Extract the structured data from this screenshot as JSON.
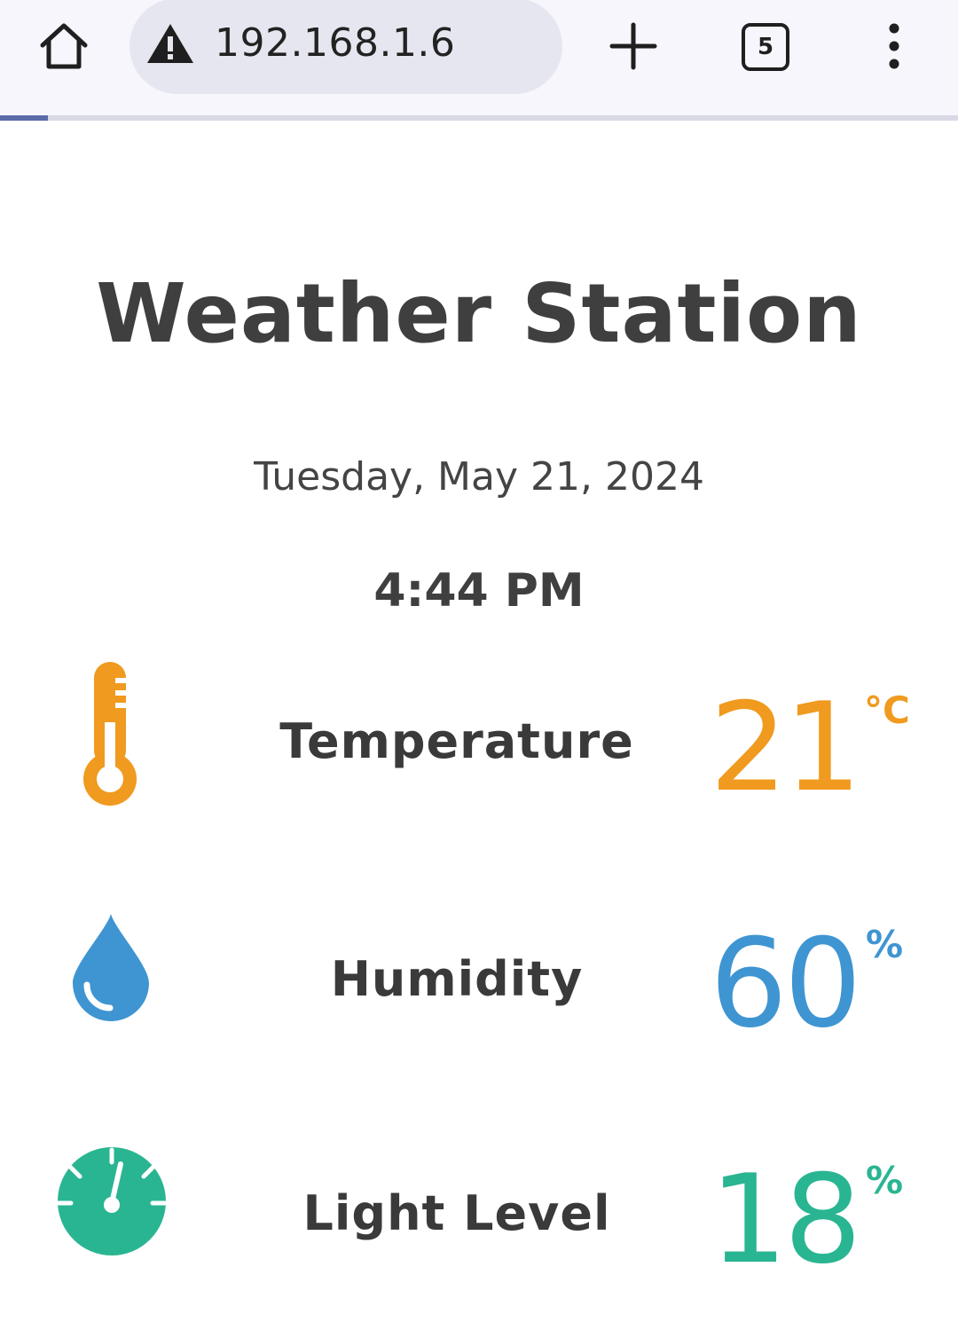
{
  "browser": {
    "url": "192.168.1.6",
    "tab_count": "5",
    "load_progress": 0.05
  },
  "page": {
    "title": "Weather Station",
    "date": "Tuesday, May 21, 2024",
    "time": "4:44 PM"
  },
  "readings": {
    "temperature": {
      "label": "Temperature",
      "value": "21",
      "unit": "°C",
      "color": "#f09a1f",
      "icon": "thermometer-icon"
    },
    "humidity": {
      "label": "Humidity",
      "value": "60",
      "unit": "%",
      "color": "#3f95d2",
      "icon": "water-drop-icon"
    },
    "light": {
      "label": "Light Level",
      "value": "18",
      "unit": "%",
      "color": "#2ab592",
      "icon": "gauge-icon"
    }
  }
}
